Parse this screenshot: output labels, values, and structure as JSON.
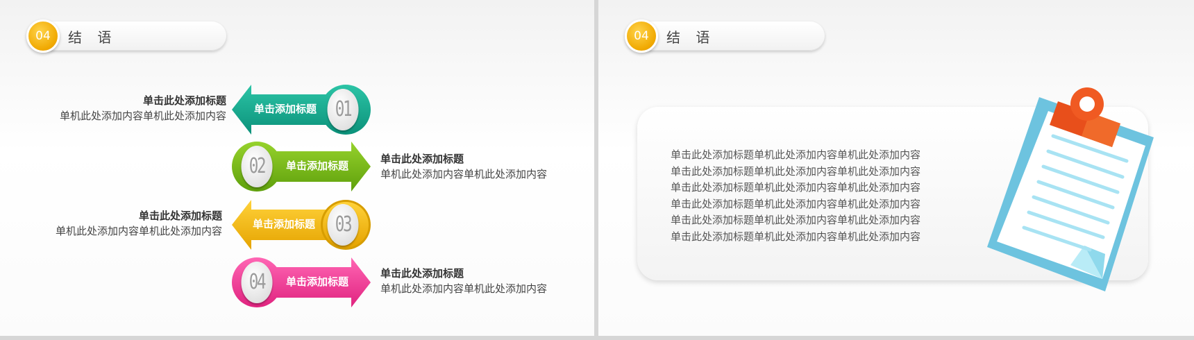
{
  "left_slide": {
    "header": {
      "number": "04",
      "title": "结 语"
    },
    "items": [
      {
        "num": "01",
        "label": "单击添加标题",
        "title": "单击此处添加标题",
        "desc": "单机此处添加内容单机此处添加内容",
        "color": "#12a98e",
        "side": "left",
        "dir": "left"
      },
      {
        "num": "02",
        "label": "单击添加标题",
        "title": "单击此处添加标题",
        "desc": "单机此处添加内容单机此处添加内容",
        "color": "#78bc18",
        "side": "right",
        "dir": "right"
      },
      {
        "num": "03",
        "label": "单击添加标题",
        "title": "单击此处添加标题",
        "desc": "单机此处添加内容单机此处添加内容",
        "color": "#f2b70a",
        "side": "left",
        "dir": "left"
      },
      {
        "num": "04",
        "label": "单击添加标题",
        "title": "单击此处添加标题",
        "desc": "单机此处添加内容单机此处添加内容",
        "color": "#f23c97",
        "side": "right",
        "dir": "right"
      }
    ]
  },
  "right_slide": {
    "header": {
      "number": "04",
      "title": "结 语"
    },
    "paragraph_lines": [
      "单击此处添加标题单机此处添加内容单机此处添加内容",
      "单击此处添加标题单机此处添加内容单机此处添加内容",
      "单击此处添加标题单机此处添加内容单机此处添加内容",
      "单击此处添加标题单机此处添加内容单机此处添加内容",
      "单击此处添加标题单机此处添加内容单机此处添加内容",
      "单击此处添加标题单机此处添加内容单机此处添加内容"
    ],
    "clipboard_icon": "clipboard-icon"
  },
  "colors": {
    "accent": "#f0a800",
    "teal": "#12a98e",
    "green": "#78bc18",
    "yellow": "#f2b70a",
    "pink": "#f23c97",
    "clip_blue": "#6dc3df",
    "clip_orange": "#f05a22"
  }
}
